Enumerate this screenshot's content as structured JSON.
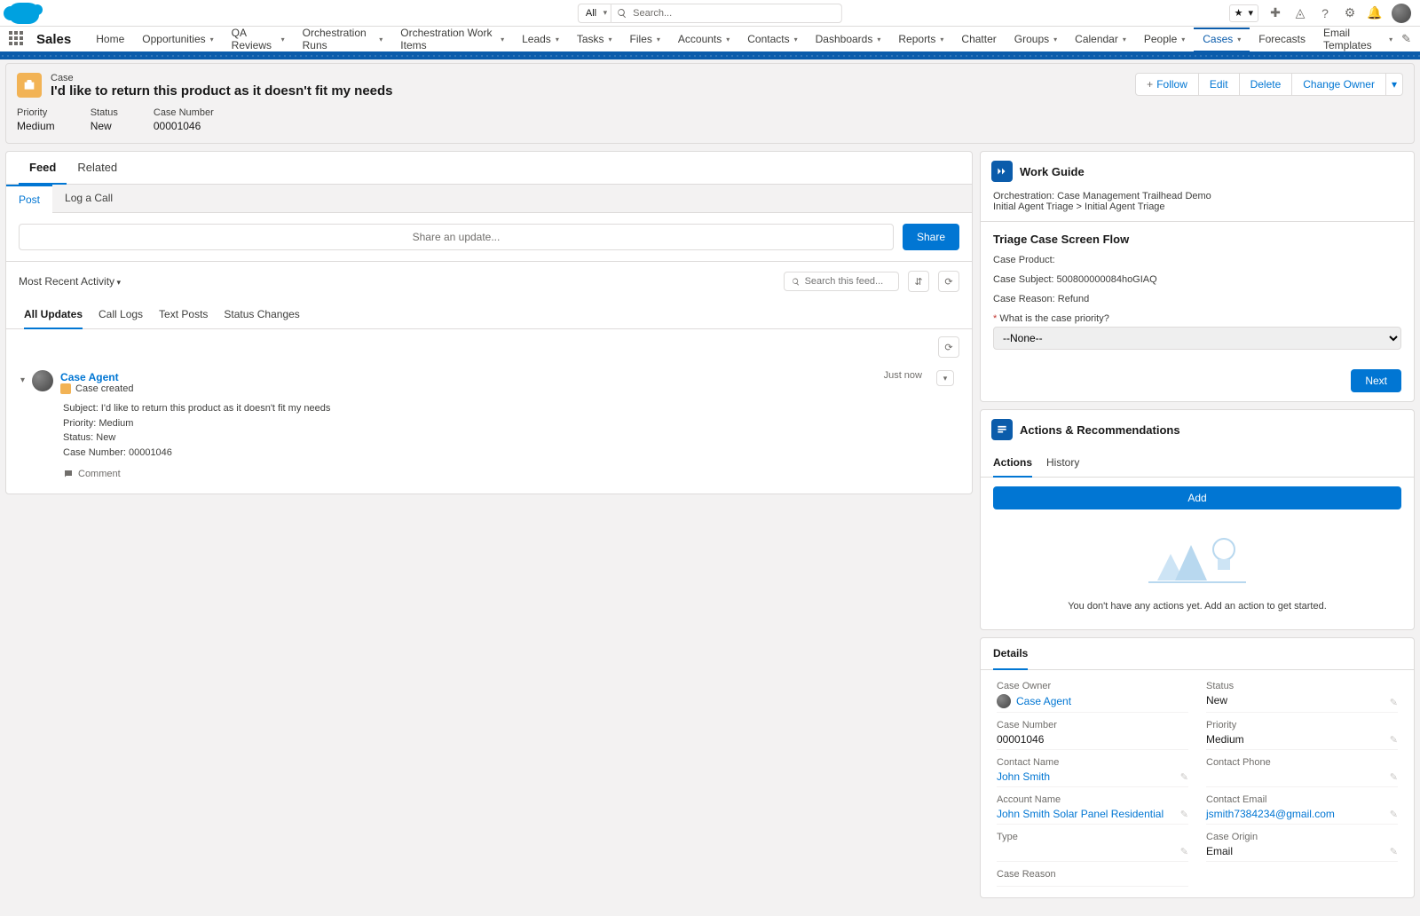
{
  "header": {
    "search_scope": "All",
    "search_placeholder": "Search..."
  },
  "nav": {
    "app": "Sales",
    "items": [
      {
        "label": "Home",
        "drop": false
      },
      {
        "label": "Opportunities",
        "drop": true
      },
      {
        "label": "QA Reviews",
        "drop": true
      },
      {
        "label": "Orchestration Runs",
        "drop": true
      },
      {
        "label": "Orchestration Work Items",
        "drop": true
      },
      {
        "label": "Leads",
        "drop": true
      },
      {
        "label": "Tasks",
        "drop": true
      },
      {
        "label": "Files",
        "drop": true
      },
      {
        "label": "Accounts",
        "drop": true
      },
      {
        "label": "Contacts",
        "drop": true
      },
      {
        "label": "Dashboards",
        "drop": true
      },
      {
        "label": "Reports",
        "drop": true
      },
      {
        "label": "Chatter",
        "drop": false
      },
      {
        "label": "Groups",
        "drop": true
      },
      {
        "label": "Calendar",
        "drop": true
      },
      {
        "label": "People",
        "drop": true
      },
      {
        "label": "Cases",
        "drop": true,
        "active": true
      },
      {
        "label": "Forecasts",
        "drop": false
      },
      {
        "label": "Email Templates",
        "drop": true
      }
    ]
  },
  "pageHeader": {
    "object": "Case",
    "title": "I'd like to return this product as it doesn't fit my needs",
    "actions": {
      "follow": "Follow",
      "edit": "Edit",
      "delete": "Delete",
      "changeOwner": "Change Owner"
    },
    "fields": [
      {
        "label": "Priority",
        "value": "Medium"
      },
      {
        "label": "Status",
        "value": "New"
      },
      {
        "label": "Case Number",
        "value": "00001046"
      }
    ]
  },
  "feed": {
    "tabs": [
      "Feed",
      "Related"
    ],
    "composerTabs": [
      "Post",
      "Log a Call"
    ],
    "sharePlaceholder": "Share an update...",
    "shareBtn": "Share",
    "sort": "Most Recent Activity",
    "searchPlaceholder": "Search this feed...",
    "filters": [
      "All Updates",
      "Call Logs",
      "Text Posts",
      "Status Changes"
    ],
    "item": {
      "author": "Case Agent",
      "event": "Case created",
      "time": "Just now",
      "lines": [
        "Subject: I'd like to return this product as it doesn't fit my needs",
        "Priority: Medium",
        "Status: New",
        "Case Number: 00001046"
      ],
      "commentLabel": "Comment"
    }
  },
  "workGuide": {
    "title": "Work Guide",
    "orchestration": "Orchestration: Case Management Trailhead Demo",
    "path": "Initial Agent Triage > Initial Agent Triage",
    "flowTitle": "Triage Case Screen Flow",
    "product": "Case Product:",
    "subject": "Case Subject: 500800000084hoGIAQ",
    "reason": "Case Reason: Refund",
    "priorityLabel": "What is the case priority?",
    "prioritySelected": "--None--",
    "next": "Next"
  },
  "actionsRec": {
    "title": "Actions & Recommendations",
    "tabs": [
      "Actions",
      "History"
    ],
    "add": "Add",
    "empty": "You don't have any actions yet. Add an action to get started."
  },
  "details": {
    "tab": "Details",
    "left": [
      {
        "label": "Case Owner",
        "value": "Case Agent",
        "link": true,
        "owner": true
      },
      {
        "label": "Case Number",
        "value": "00001046"
      },
      {
        "label": "Contact Name",
        "value": "John Smith",
        "link": true,
        "editable": true
      },
      {
        "label": "Account Name",
        "value": "John Smith Solar Panel Residential",
        "link": true,
        "editable": true
      },
      {
        "label": "Type",
        "value": "",
        "editable": true
      },
      {
        "label": "Case Reason",
        "value": ""
      }
    ],
    "right": [
      {
        "label": "Status",
        "value": "New",
        "editable": true
      },
      {
        "label": "Priority",
        "value": "Medium",
        "editable": true
      },
      {
        "label": "Contact Phone",
        "value": "",
        "editable": true
      },
      {
        "label": "Contact Email",
        "value": "jsmith7384234@gmail.com",
        "link": true,
        "editable": true
      },
      {
        "label": "Case Origin",
        "value": "Email",
        "editable": true
      }
    ]
  }
}
